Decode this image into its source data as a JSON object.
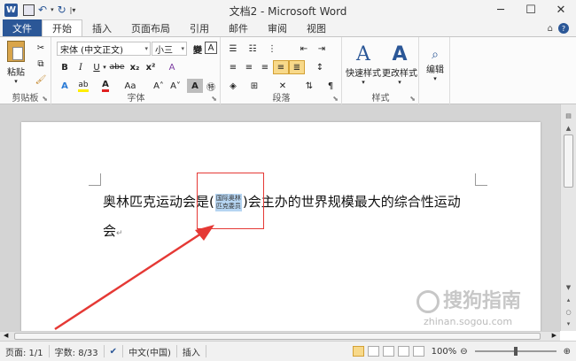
{
  "window": {
    "title": "文档2 - Microsoft Word",
    "app_icon": "W",
    "controls": [
      "─",
      "☐",
      "✕"
    ]
  },
  "qat": {
    "save_icon": "save-icon",
    "undo_icon": "undo-icon",
    "redo_icon": "redo-icon"
  },
  "tabs": {
    "file": "文件",
    "items": [
      "开始",
      "插入",
      "页面布局",
      "引用",
      "邮件",
      "审阅",
      "视图"
    ],
    "active": "开始"
  },
  "ribbon": {
    "clipboard": {
      "label": "剪贴板",
      "paste": "粘贴"
    },
    "font": {
      "label": "字体",
      "font_name": "宋体 (中文正文)",
      "font_size": "小三",
      "bold": "B",
      "italic": "I",
      "underline": "U",
      "strike": "abe",
      "subscript": "x₂",
      "superscript": "x²",
      "grow": "A˄",
      "shrink": "A˅",
      "phonetic": "變",
      "border_char": "A",
      "change_case": "Aa",
      "clear": "A",
      "shade": "A",
      "enclose": "㊕"
    },
    "paragraph": {
      "label": "段落"
    },
    "styles": {
      "label": "样式",
      "quick_styles": "快速样式",
      "change_styles": "更改样式"
    },
    "editing": {
      "label": "编辑"
    }
  },
  "document": {
    "line1_before": "奥林匹克运动会是(",
    "ruby_top": "国际奥林",
    "ruby_bottom": "匹克委员",
    "line1_after": ")会主办的世界规模最大的综合性运动",
    "line2": "会",
    "line2_mark": "↵"
  },
  "statusbar": {
    "page": "页面: 1/1",
    "words": "字数: 8/33",
    "language": "中文(中国)",
    "mode": "插入",
    "zoom": "100%",
    "zoom_value": 100
  },
  "watermark": {
    "text": "搜狗指南",
    "url": "zhinan.sogou.com"
  },
  "colors": {
    "file_tab": "#2b5797",
    "selection": "#b6d5f2",
    "annotation": "#e53935"
  }
}
